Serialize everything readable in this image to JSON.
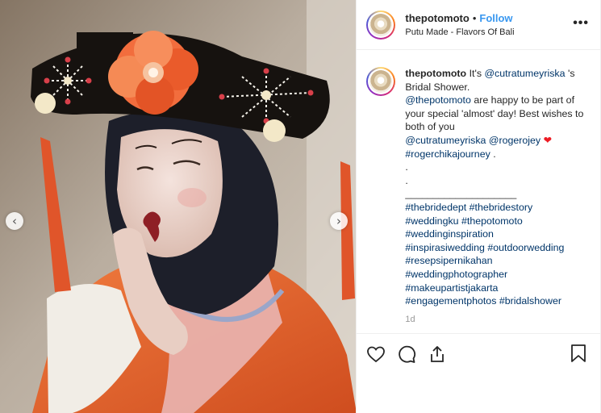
{
  "post": {
    "username": "thepotomoto",
    "separator": "•",
    "follow_label": "Follow",
    "location": "Putu Made - Flavors Of Bali",
    "more_label": "•••"
  },
  "caption": {
    "username": "thepotomoto",
    "t1": "It's",
    "m1": "@cutratumeyriska",
    "t2": "'s Bridal Shower.",
    "m2": "@thepotomoto",
    "t3": "are happy to be part of your special 'almost' day! Best wishes to both of you",
    "m3": "@cutratumeyriska",
    "m4": "@rogerojey",
    "heart": "❤",
    "h1": "#rogerchikajourney",
    "t4": ".",
    "dot1": ".",
    "dot2": ".",
    "separator": "____________________",
    "hashtags": [
      "#thebridedept",
      "#thebridestory",
      "#weddingku",
      "#thepotomoto",
      "#weddinginspiration",
      "#inspirasiwedding",
      "#outdoorwedding",
      "#resepsipernikahan",
      "#weddingphotographer",
      "#makeupartistjakarta",
      "#engagementphotos",
      "#bridalshower"
    ],
    "time": "1d"
  },
  "carousel": {
    "prev_icon": "chevron-left",
    "next_icon": "chevron-right",
    "prev_glyph": "‹",
    "next_glyph": "›"
  },
  "colors": {
    "link": "#003569",
    "follow": "#3897f0",
    "heart": "#ed1c24",
    "headpiece": "#1a1412",
    "flower": "#f06a3a",
    "robe": "#e8692f"
  }
}
